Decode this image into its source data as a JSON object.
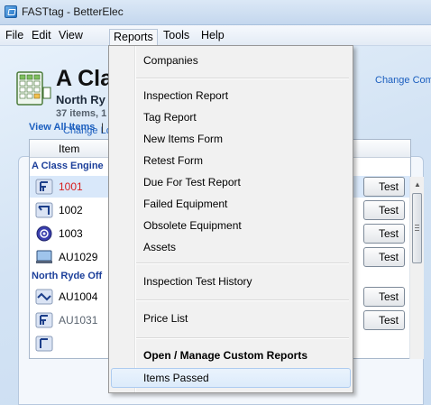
{
  "window": {
    "title": "FASTtag - BetterElec"
  },
  "menubar": {
    "items": [
      "File",
      "Edit",
      "View",
      "Reports",
      "Tools",
      "Help"
    ],
    "active": "Reports"
  },
  "header": {
    "company_name": "A Cla",
    "location_name": "North Ry",
    "summary": "37 items, 1",
    "change_location": "Change Lo",
    "change_company": "Change Com"
  },
  "panel": {
    "view_all_label": "View All Items",
    "separator": "|"
  },
  "grid": {
    "column_item": "Item",
    "groups": [
      {
        "name": "A Class Engine",
        "rows": [
          {
            "label": "1001",
            "icon": "plug-icon",
            "label_color": "#d81f1f",
            "selected": true,
            "button": "Test"
          },
          {
            "label": "1002",
            "icon": "cable-icon",
            "selected": false,
            "button": "Test"
          },
          {
            "label": "1003",
            "icon": "rcd-icon",
            "selected": false,
            "button": "Test"
          },
          {
            "label": "AU1029",
            "icon": "laptop-icon",
            "selected": false,
            "button": "Test"
          }
        ]
      },
      {
        "name": "North Ryde Off",
        "rows": [
          {
            "label": "AU1004",
            "icon": "cord-icon",
            "selected": false,
            "button": "Test"
          },
          {
            "label": "AU1031",
            "icon": "plug-icon",
            "label_color": "#5a6470",
            "selected": false,
            "button": "Test"
          }
        ]
      }
    ]
  },
  "reports_menu": {
    "items": [
      {
        "label": "Companies"
      },
      {
        "label": "Inspection Report"
      },
      {
        "label": "Tag Report"
      },
      {
        "label": "New Items Form"
      },
      {
        "label": "Retest Form"
      },
      {
        "label": "Due For Test Report"
      },
      {
        "label": "Failed Equipment"
      },
      {
        "label": "Obsolete Equipment"
      },
      {
        "label": "Assets"
      },
      {
        "label": "Inspection Test History"
      },
      {
        "label": "Price List"
      },
      {
        "label": "Open / Manage Custom Reports",
        "bold": true
      },
      {
        "label": "Items Passed",
        "highlighted": true
      }
    ]
  },
  "colors": {
    "link": "#1c5fbf",
    "failed_item": "#d81f1f",
    "menu_highlight": "#dcebfb"
  }
}
